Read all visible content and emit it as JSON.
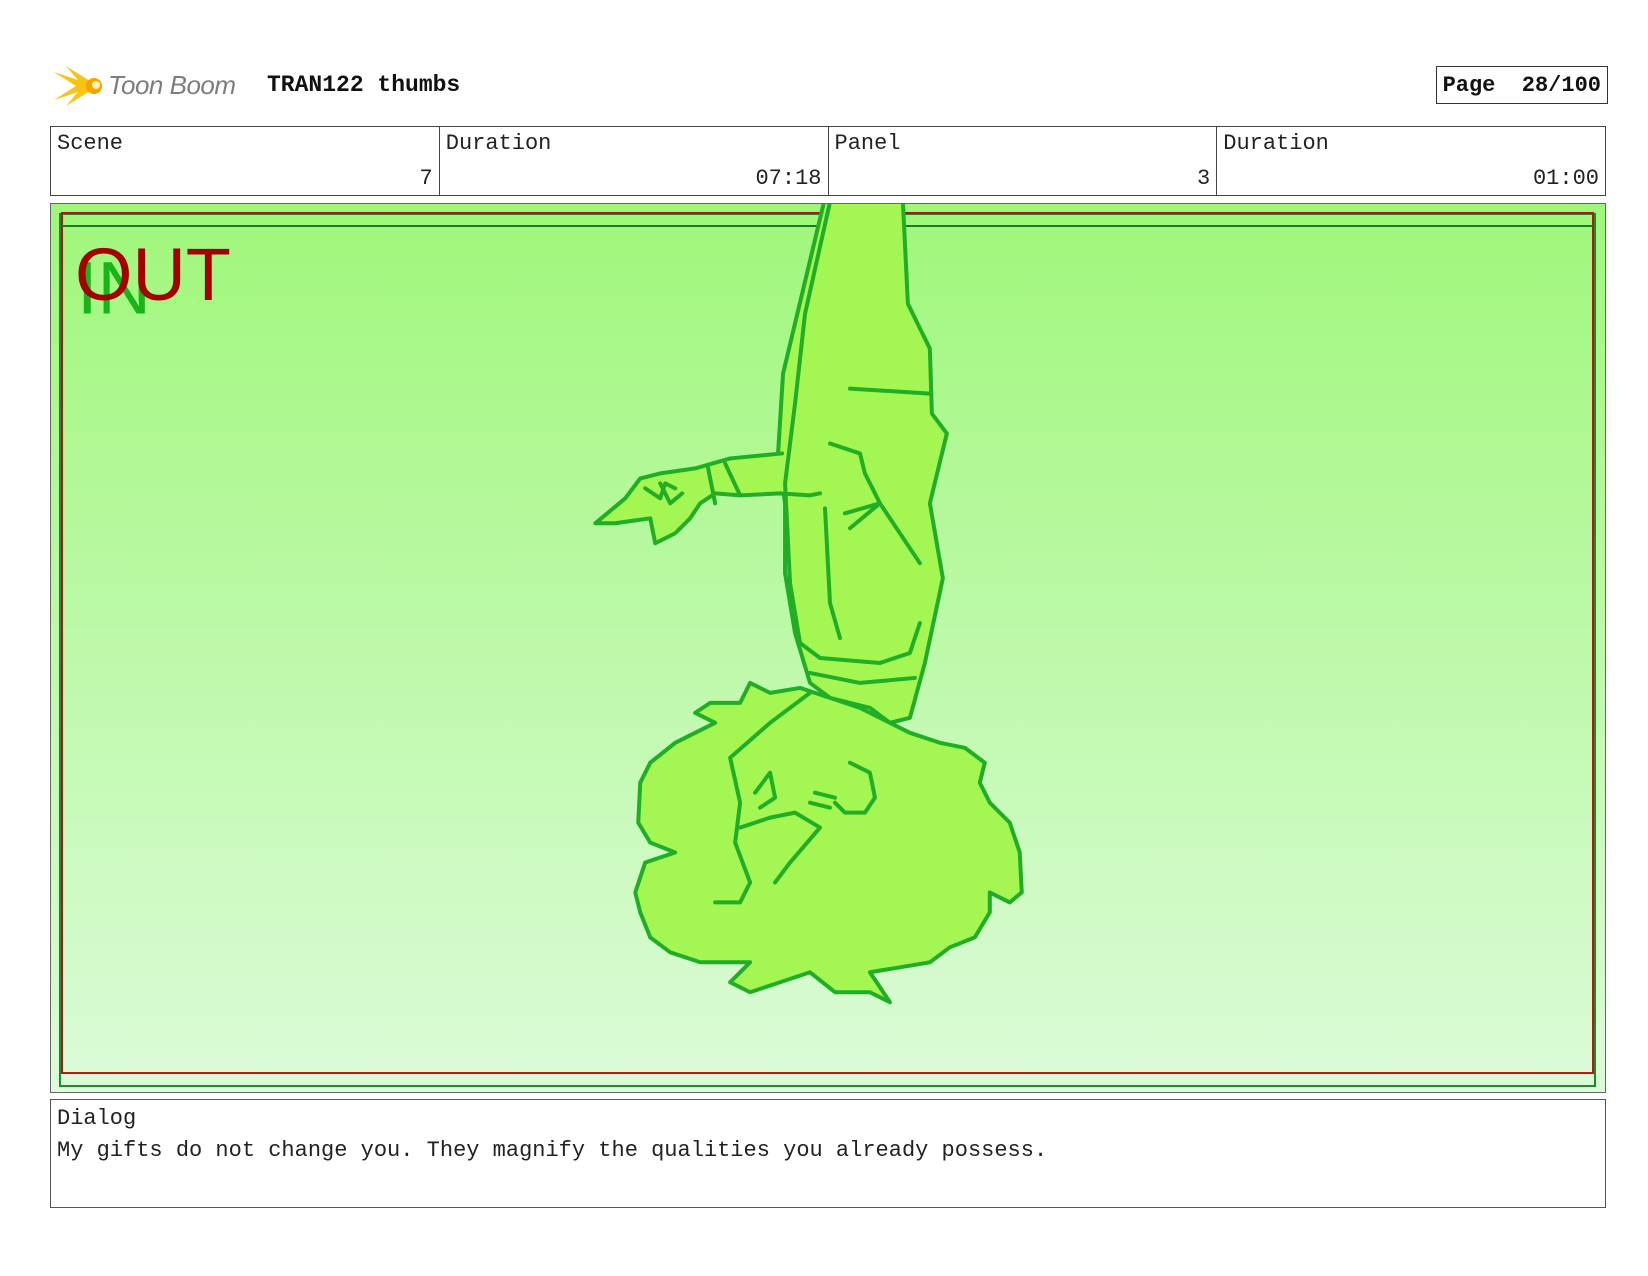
{
  "header": {
    "logo_text": "Toon Boom",
    "title": "TRAN122 thumbs",
    "page": "Page  28/100"
  },
  "info": {
    "scene_label": "Scene",
    "scene_value": "7",
    "duration_label": "Duration",
    "duration_value": "07:18",
    "panel_label": "Panel",
    "panel_value": "3",
    "panel_duration_label": "Duration",
    "panel_duration_value": "01:00"
  },
  "panel": {
    "in_label": "IN",
    "out_label": "OUT",
    "colors": {
      "gradient_top": "#9ff77a",
      "gradient_bottom": "#dcfbd9",
      "line": "#1fae25",
      "fill": "#a4f653",
      "out_color": "#a50000",
      "in_color": "#18b518"
    }
  },
  "dialog": {
    "label": "Dialog",
    "text": "My gifts do not change you. They magnify the qualities you already possess."
  }
}
